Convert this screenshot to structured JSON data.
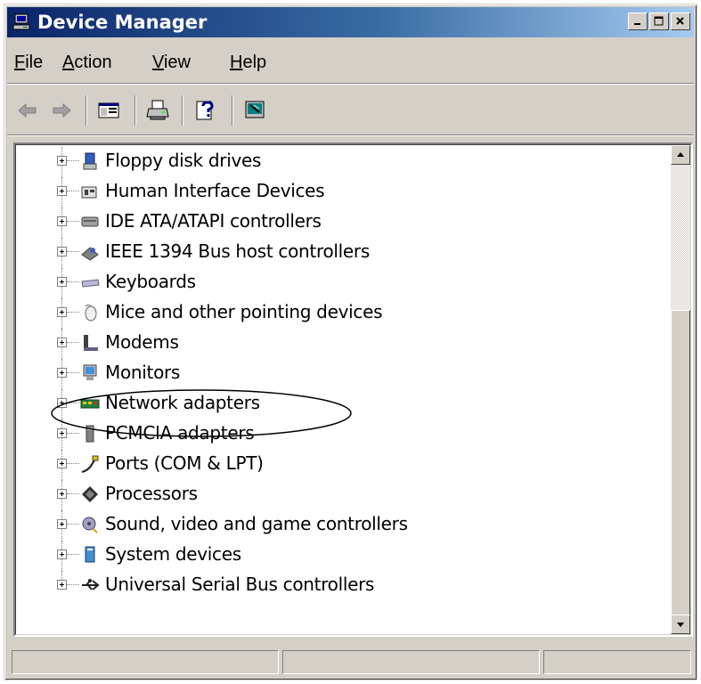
{
  "window": {
    "title": "Device Manager",
    "title_icon": "computer-monitor-icon",
    "title_colors": {
      "start": "#0a246a",
      "end": "#a6caf0"
    }
  },
  "controls": {
    "minimize_icon": "minimize-icon",
    "maximize_icon": "maximize-icon",
    "close_icon": "close-icon"
  },
  "menu": [
    {
      "label_rest": "ile",
      "mnemonic": "F",
      "full": "File"
    },
    {
      "label_rest": "ction",
      "mnemonic": "A",
      "full": "Action"
    },
    {
      "label_rest": "iew",
      "mnemonic": "V",
      "full": "View"
    },
    {
      "label_rest": "elp",
      "mnemonic": "H",
      "full": "Help"
    }
  ],
  "toolbar": {
    "back_icon": "back-arrow-icon",
    "forward_icon": "forward-arrow-icon",
    "console_tree_icon": "show-hide-console-tree-icon",
    "print_icon": "print-icon",
    "help_icon": "help-icon",
    "properties_icon": "scan-hardware-icon"
  },
  "tree": {
    "items": [
      {
        "label": "Floppy disk drives",
        "icon": "floppy-drive-icon"
      },
      {
        "label": "Human Interface Devices",
        "icon": "hid-icon"
      },
      {
        "label": "IDE ATA/ATAPI controllers",
        "icon": "ide-controller-icon"
      },
      {
        "label": "IEEE 1394 Bus host controllers",
        "icon": "ieee1394-icon"
      },
      {
        "label": "Keyboards",
        "icon": "keyboard-icon"
      },
      {
        "label": "Mice and other pointing devices",
        "icon": "mouse-icon"
      },
      {
        "label": "Modems",
        "icon": "modem-icon"
      },
      {
        "label": "Monitors",
        "icon": "monitor-icon"
      },
      {
        "label": "Network adapters",
        "icon": "network-adapter-icon"
      },
      {
        "label": "PCMCIA adapters",
        "icon": "pcmcia-icon"
      },
      {
        "label": "Ports (COM & LPT)",
        "icon": "port-icon"
      },
      {
        "label": "Processors",
        "icon": "processor-icon"
      },
      {
        "label": "Sound, video and game controllers",
        "icon": "sound-icon"
      },
      {
        "label": "System devices",
        "icon": "system-device-icon"
      },
      {
        "label": "Universal Serial Bus controllers",
        "icon": "usb-icon"
      }
    ],
    "highlighted_item": "Network adapters"
  },
  "statusbar": {
    "panels": [
      "",
      "",
      ""
    ]
  },
  "colors": {
    "face": "#d4d0c8",
    "highlight_circle": "#000000"
  }
}
